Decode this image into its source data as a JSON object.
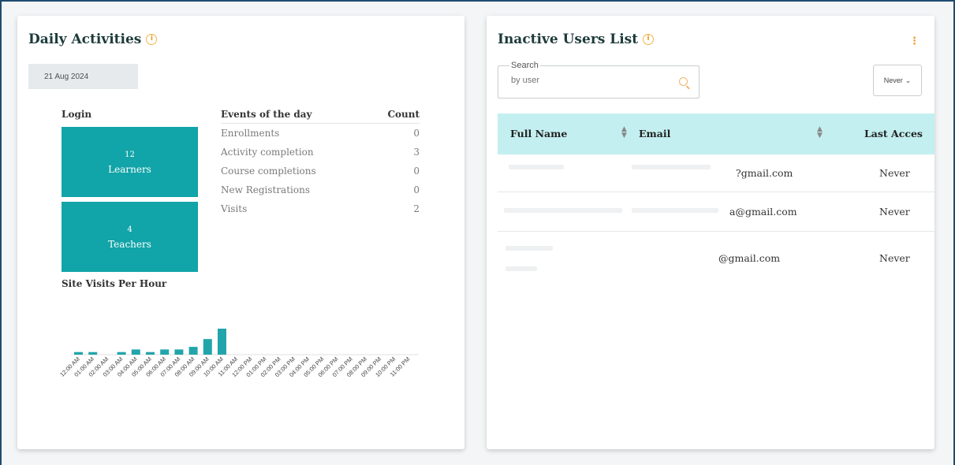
{
  "daily": {
    "title": "Daily Activities",
    "date": "21 Aug 2024",
    "login_label": "Login",
    "stats": [
      {
        "count": "12",
        "label": "Learners"
      },
      {
        "count": "4",
        "label": "Teachers"
      }
    ],
    "events_header": {
      "name": "Events of the day",
      "count": "Count"
    },
    "events": [
      {
        "name": "Enrollments",
        "count": "0"
      },
      {
        "name": "Activity completion",
        "count": "3"
      },
      {
        "name": "Course completions",
        "count": "0"
      },
      {
        "name": "New Registrations",
        "count": "0"
      },
      {
        "name": "Visits",
        "count": "2"
      }
    ],
    "site_visits_label": "Site Visits Per Hour"
  },
  "chart_data": {
    "type": "bar",
    "categories": [
      "12:00 AM",
      "01:00 AM",
      "02:00 AM",
      "03:00 AM",
      "04:00 AM",
      "05:00 AM",
      "06:00 AM",
      "07:00 AM",
      "08:00 AM",
      "09:00 AM",
      "10:00 AM",
      "11:00 AM",
      "12:00 PM",
      "01:00 PM",
      "02:00 PM",
      "03:00 PM",
      "04:00 PM",
      "05:00 PM",
      "06:00 PM",
      "07:00 PM",
      "08:00 PM",
      "09:00 PM",
      "10:00 PM",
      "11:00 PM"
    ],
    "values": [
      1,
      1,
      0,
      1,
      2,
      1,
      2,
      2,
      3,
      6,
      10,
      0,
      0,
      0,
      0,
      0,
      0,
      0,
      0,
      0,
      0,
      0,
      0,
      0
    ],
    "color": "#22a5aa"
  },
  "inactive": {
    "title": "Inactive Users List",
    "search_legend": "Search",
    "search_placeholder": "by user",
    "filter_value": "Never",
    "columns": {
      "name": "Full Name",
      "email": "Email",
      "last": "Last Acces"
    },
    "rows": [
      {
        "email": "?gmail.com",
        "last": "Never"
      },
      {
        "email": "a@gmail.com",
        "last": "Never"
      },
      {
        "email": "@gmail.com",
        "last": "Never"
      }
    ]
  },
  "colors": {
    "teal": "#11a4a8",
    "header_bg": "#c4eff0",
    "accent": "#f09a2a"
  }
}
